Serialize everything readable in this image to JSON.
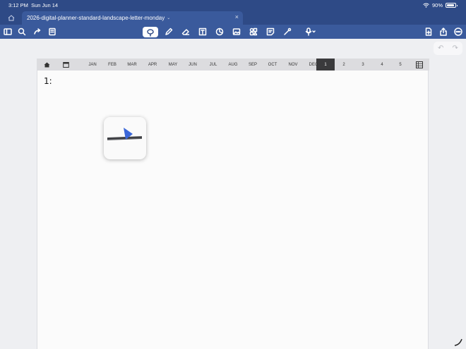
{
  "status_bar": {
    "time": "3:12 PM",
    "date": "Sun Jun 14",
    "battery": "90%",
    "icons": [
      "wifi-icon",
      "battery-icon"
    ]
  },
  "tabs": {
    "document_title": "2026-digital-planner-standard-landscape-letter-monday"
  },
  "toolbar": {
    "left_tools": [
      "sidebar-icon",
      "search-icon",
      "share-arrow-icon",
      "bookmark-list-icon"
    ],
    "center_tools": [
      "lasso-icon",
      "pen-icon",
      "eraser-icon",
      "text-box-icon",
      "shapes-icon",
      "image-icon",
      "elements-icon",
      "sticky-note-icon",
      "laser-pointer-icon",
      "microphone-icon"
    ],
    "right_tools": [
      "add-page-icon",
      "export-icon",
      "more-icon"
    ],
    "active_tool": "lasso-icon"
  },
  "planner": {
    "nav": {
      "months": [
        "JAN",
        "FEB",
        "MAR",
        "APR",
        "MAY",
        "JUN",
        "JUL",
        "AUG",
        "SEP",
        "OCT",
        "NOV",
        "DEC"
      ],
      "days": [
        "1",
        "2",
        "3",
        "4",
        "5"
      ],
      "active_day": "1"
    },
    "page_label": "1:"
  },
  "colors": {
    "chrome": "#2e4a86",
    "toolbar": "#3a5a9c",
    "page": "#fbfbfb",
    "month_bar": "#dcdcdf",
    "active_day": "#3a3a3c",
    "accent_blue": "#3b67d8"
  }
}
